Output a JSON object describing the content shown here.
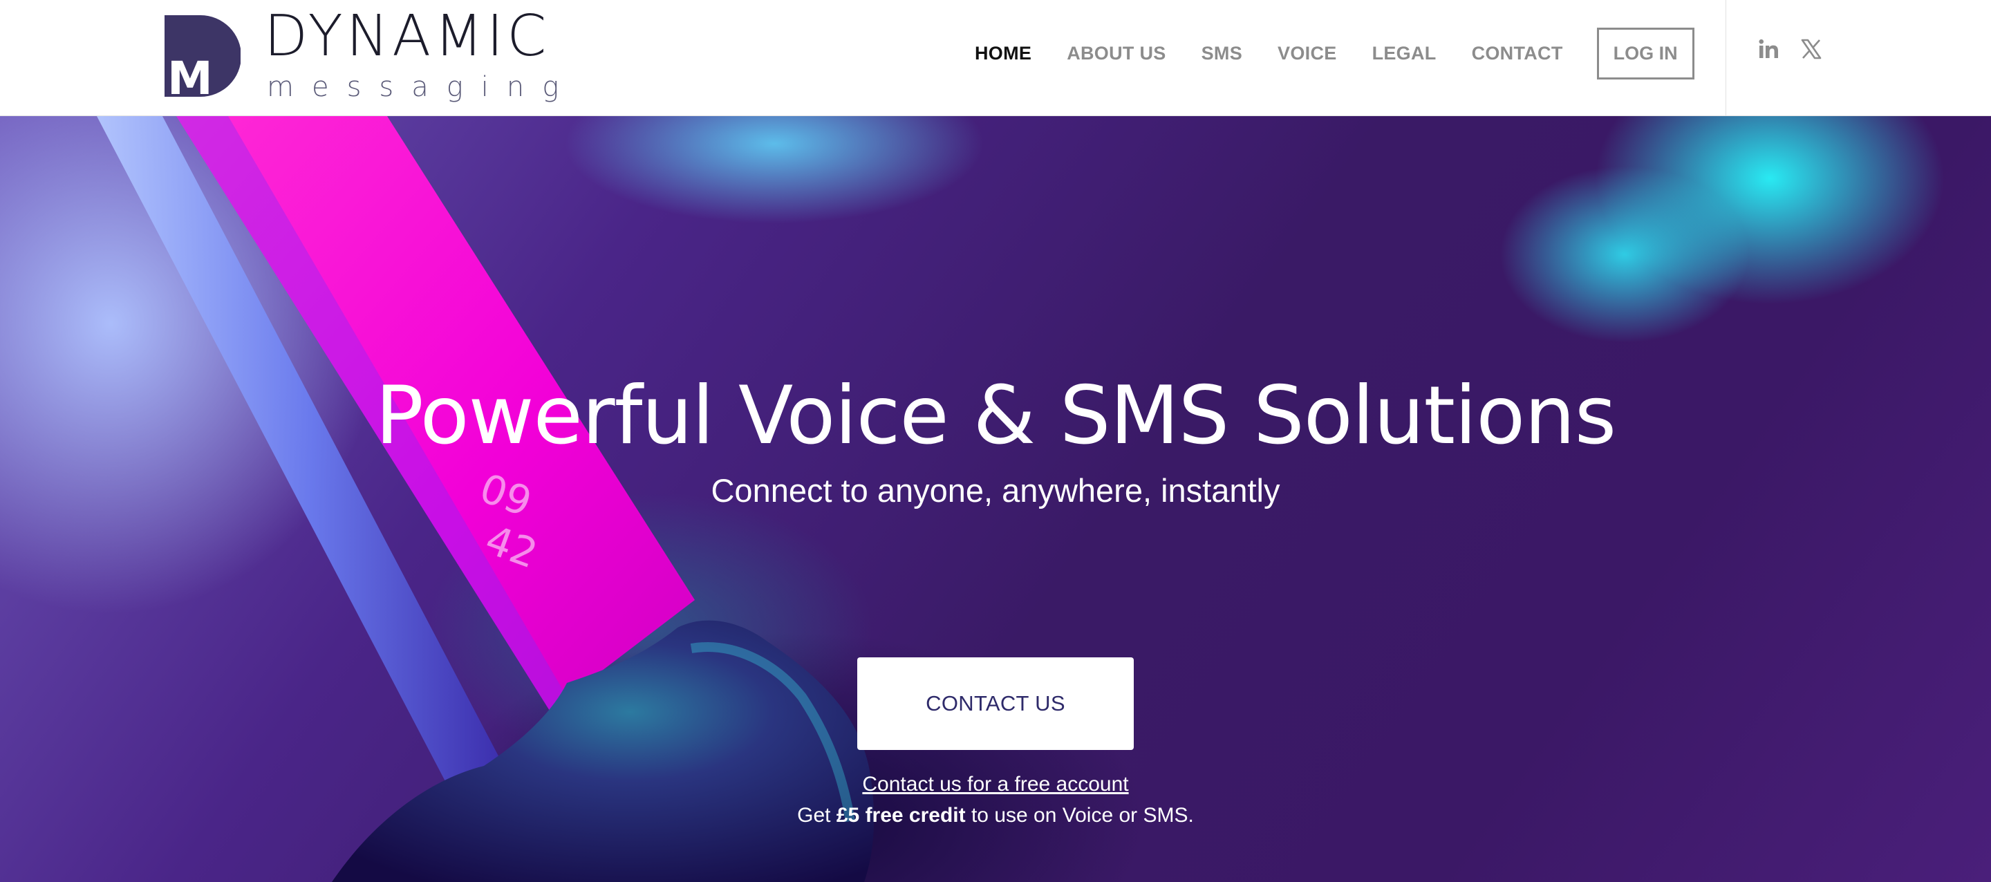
{
  "header": {
    "logo": {
      "word": "DYNAMIC",
      "sub": "messaging",
      "mark_letter": "M"
    },
    "nav": [
      "HOME",
      "ABOUT US",
      "SMS",
      "VOICE",
      "LEGAL",
      "CONTACT"
    ],
    "active_nav": "HOME",
    "login_label": "LOG IN",
    "social_icons": [
      "linkedin-icon",
      "x-icon"
    ]
  },
  "hero": {
    "title": "Powerful Voice & SMS Solutions",
    "subtitle": "Connect to anyone, anywhere, instantly",
    "cta_label": "CONTACT US",
    "free_account_link": "Contact us for a free account",
    "credit": {
      "prefix": "Get ",
      "bold": "£5 free credit",
      "suffix": " to use on Voice or SMS."
    },
    "phone_clock": [
      "09",
      "42"
    ]
  },
  "colors": {
    "brand": "#3d3566",
    "nav_active": "#111111",
    "nav_inactive": "#8c8c8c",
    "hero_purple": "#3b1866",
    "hero_cyan": "#28f5fa",
    "phone_magenta": "#f200d8",
    "cta_text": "#2e2a6a"
  }
}
